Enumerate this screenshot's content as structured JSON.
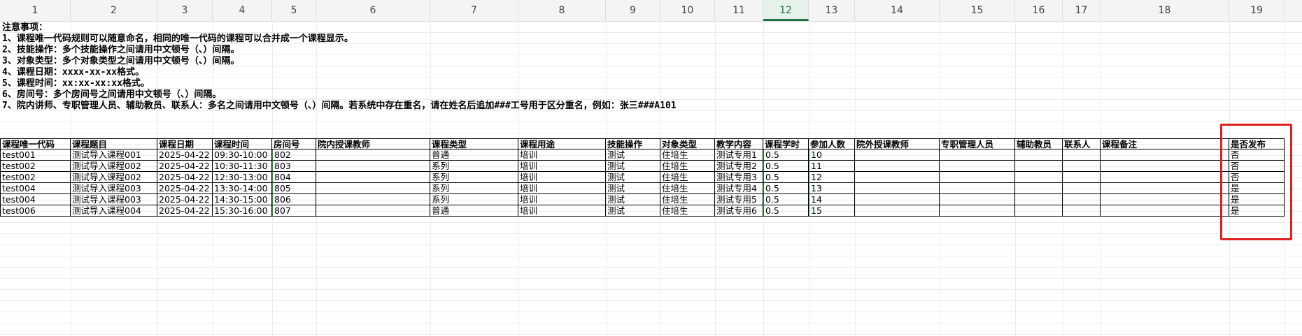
{
  "column_headers": [
    "1",
    "2",
    "3",
    "4",
    "5",
    "6",
    "7",
    "8",
    "9",
    "10",
    "11",
    "12",
    "13",
    "14",
    "15",
    "16",
    "17",
    "18",
    "19"
  ],
  "selected_column": "12",
  "notes": [
    "注意事项：",
    "1、课程唯一代码规则可以随意命名，相同的唯一代码的课程可以合并成一个课程显示。",
    "2、技能操作：多个技能操作之间请用中文顿号（、）间隔。",
    "3、对象类型：多个对象类型之间请用中文顿号（、）间隔。",
    "4、课程日期：xxxx-xx-xx格式。",
    "5、课程时间：xx:xx-xx:xx格式。",
    "6、房间号：多个房间号之间请用中文顿号（、）间隔。",
    "7、院内讲师、专职管理人员、辅助教员、联系人：多名之间请用中文顿号（、）间隔。若系统中存在重名，请在姓名后追加###工号用于区分重名，例如：张三###A101"
  ],
  "table": {
    "headers": [
      "课程唯一代码",
      "课程题目",
      "课程日期",
      "课程时间",
      "房间号",
      "院内授课教师",
      "课程类型",
      "课程用途",
      "技能操作",
      "对象类型",
      "教学内容",
      "课程学时",
      "参加人数",
      "院外授课教师",
      "专职管理人员",
      "辅助教员",
      "联系人",
      "课程备注",
      "是否发布"
    ],
    "rows": [
      [
        "test001",
        "测试导入课程001",
        "2025-04-22",
        "09:30-10:00",
        "802",
        "",
        "普通",
        "培训",
        "测试",
        "住培生",
        "测试专用1",
        "0.5",
        "10",
        "",
        "",
        "",
        "",
        "",
        "否"
      ],
      [
        "test002",
        "测试导入课程002",
        "2025-04-22",
        "10:30-11:30",
        "803",
        "",
        "系列",
        "培训",
        "测试",
        "住培生",
        "测试专用2",
        "0.5",
        "11",
        "",
        "",
        "",
        "",
        "",
        "否"
      ],
      [
        "test002",
        "测试导入课程002",
        "2025-04-22",
        "12:30-13:00",
        "804",
        "",
        "系列",
        "培训",
        "测试",
        "住培生",
        "测试专用3",
        "0.5",
        "12",
        "",
        "",
        "",
        "",
        "",
        "否"
      ],
      [
        "test004",
        "测试导入课程003",
        "2025-04-22",
        "13:30-14:00",
        "805",
        "",
        "系列",
        "培训",
        "测试",
        "住培生",
        "测试专用4",
        "0.5",
        "13",
        "",
        "",
        "",
        "",
        "",
        "是"
      ],
      [
        "test004",
        "测试导入课程003",
        "2025-04-22",
        "14:30-15:00",
        "806",
        "",
        "系列",
        "培训",
        "测试",
        "住培生",
        "测试专用5",
        "0.5",
        "14",
        "",
        "",
        "",
        "",
        "",
        "是"
      ],
      [
        "test006",
        "测试导入课程004",
        "2025-04-22",
        "15:30-16:00",
        "807",
        "",
        "普通",
        "培训",
        "测试",
        "住培生",
        "测试专用6",
        "0.5",
        "15",
        "",
        "",
        "",
        "",
        "",
        "是"
      ]
    ]
  },
  "highlight_color": "#e02020",
  "accent_color": "#217346"
}
